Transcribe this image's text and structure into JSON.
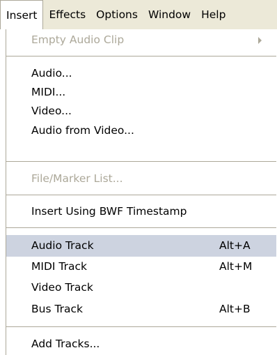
{
  "menubar": {
    "items": [
      "Insert",
      "Effects",
      "Options",
      "Window",
      "Help"
    ],
    "active": "Insert"
  },
  "menu": {
    "empty_audio_clip": "Empty Audio Clip",
    "audio": "Audio...",
    "midi": "MIDI...",
    "video": "Video...",
    "audio_from_video": "Audio from Video...",
    "file_marker_list": "File/Marker List...",
    "insert_using_bwf": "Insert Using BWF Timestamp",
    "audio_track": "Audio Track",
    "audio_track_shortcut": "Alt+A",
    "midi_track": "MIDI Track",
    "midi_track_shortcut": "Alt+M",
    "video_track": "Video Track",
    "bus_track": "Bus Track",
    "bus_track_shortcut": "Alt+B",
    "add_tracks": "Add Tracks..."
  },
  "colors": {
    "menubar_bg": "#ece9d8",
    "highlight_bg": "#cdd3e0",
    "disabled_text": "#aca899",
    "separator": "#aca899"
  }
}
